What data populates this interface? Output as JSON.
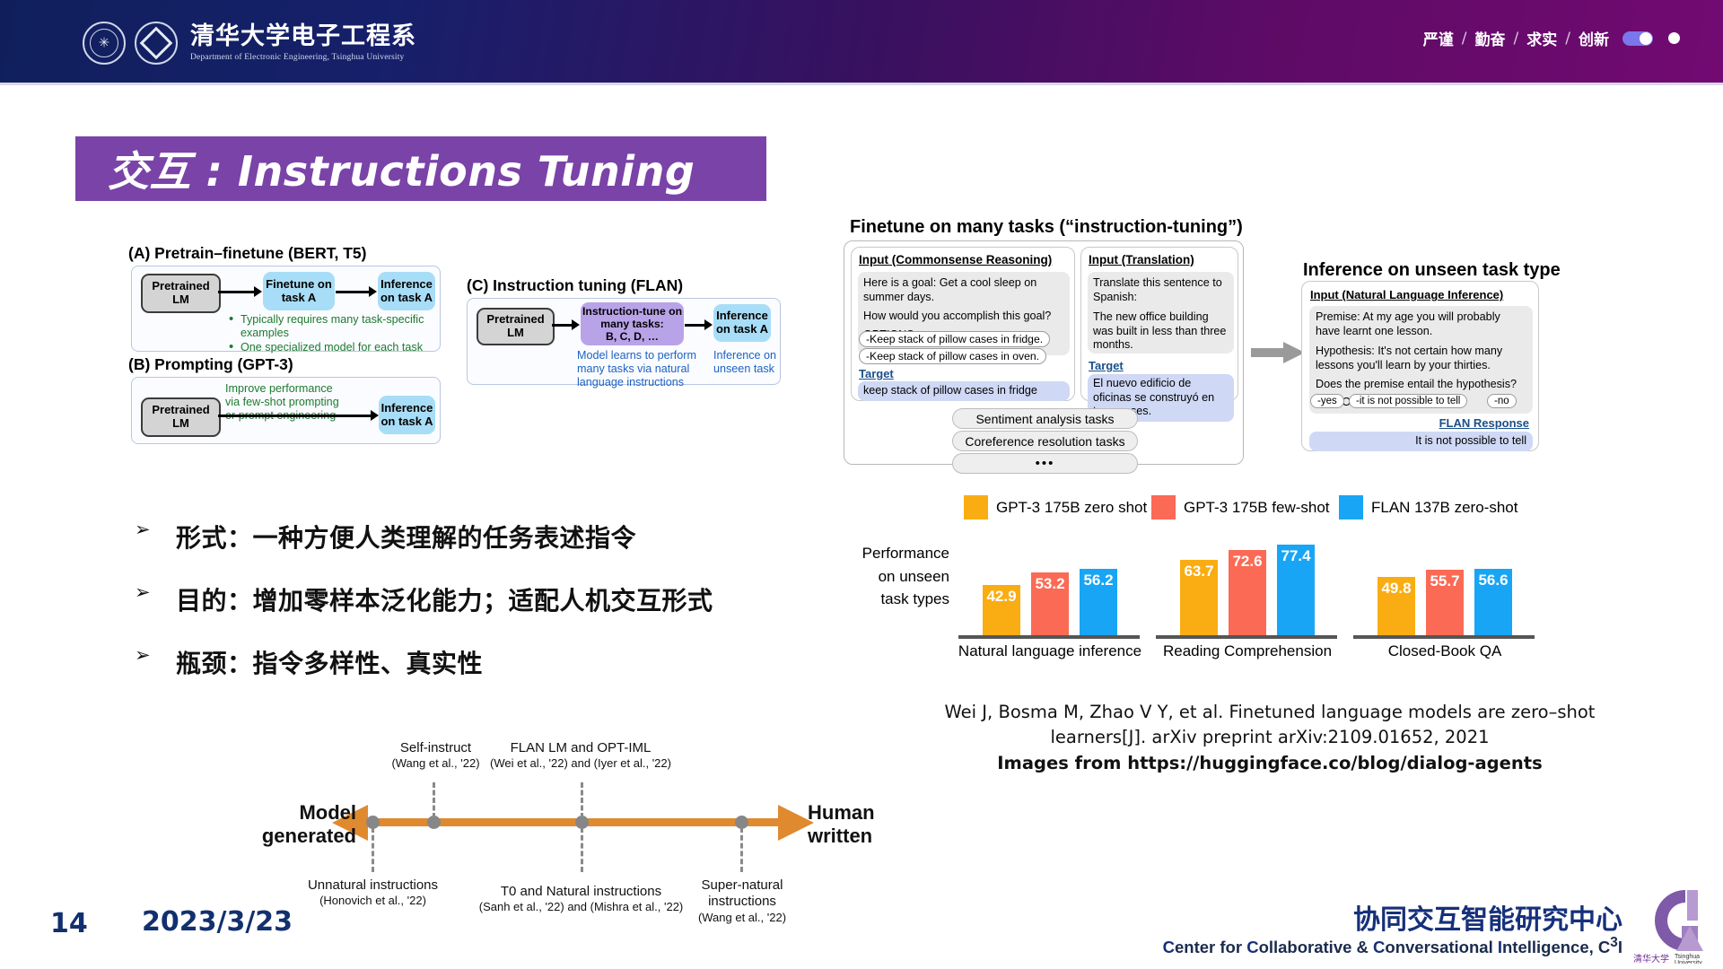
{
  "header": {
    "logo_cn": "清华大学电子工程系",
    "logo_en": "Department of Electronic Engineering, Tsinghua University",
    "motto": [
      "严谨",
      "勤奋",
      "求实",
      "创新"
    ],
    "separator": "/"
  },
  "title": {
    "text": "交互 : Instructions Tuning"
  },
  "diagrams": {
    "a": {
      "heading": "(A) Pretrain–finetune (BERT, T5)",
      "nodes": {
        "pretrained": "Pretrained\nLM",
        "finetune": "Finetune on\ntask A",
        "inference": "Inference\non task A"
      },
      "notes": [
        "Typically requires many task-specific examples",
        "One specialized model for each task"
      ]
    },
    "b": {
      "heading": "(B) Prompting (GPT-3)",
      "nodes": {
        "pretrained": "Pretrained\nLM",
        "inference": "Inference\non task A"
      },
      "note": "Improve performance\nvia few-shot prompting\nor prompt engineering"
    },
    "c": {
      "heading": "(C) Instruction tuning (FLAN)",
      "nodes": {
        "pretrained": "Pretrained\nLM",
        "tune": "Instruction-tune on\nmany tasks:\nB, C, D, …",
        "inference": "Inference\non task A"
      },
      "note_left": "Model learns to perform\nmany tasks via natural\nlanguage instructions",
      "note_right": "Inference on\nunseen task"
    }
  },
  "flan": {
    "finetune_title": "Finetune on many tasks (“instruction-tuning”)",
    "commonsense": {
      "header": "Input (Commonsense Reasoning)",
      "body_lines": [
        "Here is a goal: Get a cool sleep on summer days.",
        "How would you accomplish this goal?",
        "OPTIONS:"
      ],
      "options": [
        "-Keep stack of pillow cases in fridge.",
        "-Keep stack of pillow cases in oven."
      ],
      "target_label": "Target",
      "target_text": "keep stack of pillow cases in fridge"
    },
    "translation": {
      "header": "Input (Translation)",
      "body_lines": [
        "Translate this sentence to Spanish:",
        "The new office building was built in less than three months."
      ],
      "target_label": "Target",
      "target_text": "El nuevo edificio de oficinas se construyó en tres meses."
    },
    "more_tasks": [
      "Sentiment analysis tasks",
      "Coreference resolution tasks",
      "•••"
    ],
    "inference_title": "Inference on unseen task type",
    "nli": {
      "header": "Input (Natural Language Inference)",
      "body_lines": [
        "Premise: At my age you will probably have learnt one lesson.",
        "Hypothesis: It's not certain how many lessons you'll learn by your thirties.",
        "Does the premise entail the hypothesis?",
        "OPTIONS:"
      ],
      "options": [
        "-yes",
        "-it is not possible to tell",
        "-no"
      ],
      "response_label": "FLAN Response",
      "response_text": "It is not possible to tell"
    }
  },
  "bullets": [
    {
      "marker": "➢",
      "text": "形式：一种方便人类理解的任务表述指令"
    },
    {
      "marker": "➢",
      "text": "目的：增加零样本泛化能力；适配人机交互形式"
    },
    {
      "marker": "➢",
      "text": "瓶颈：指令多样性、真实性"
    }
  ],
  "chart_data": {
    "type": "bar",
    "title": "",
    "ylabel": "Performance on unseen task types",
    "ylabel_lines": [
      "Performance",
      "on unseen",
      "task types"
    ],
    "categories": [
      "Natural language inference",
      "Reading Comprehension",
      "Closed-Book QA"
    ],
    "series": [
      {
        "name": "GPT-3 175B zero shot",
        "color": "#f9ad13",
        "values": [
          42.9,
          63.7,
          49.8
        ]
      },
      {
        "name": "GPT-3 175B few-shot",
        "color": "#fb6a55",
        "values": [
          53.2,
          72.6,
          55.7
        ]
      },
      {
        "name": "FLAN 137B zero-shot",
        "color": "#18a5f5",
        "values": [
          56.2,
          77.4,
          56.6
        ]
      }
    ],
    "ylim": [
      0,
      90
    ],
    "grid": false,
    "legend_position": "top"
  },
  "citation": {
    "line1": "Wei J, Bosma M, Zhao V Y, et al. Finetuned language models are zero–shot",
    "line2": "learners[J]. arXiv preprint arXiv:2109.01652, 2021",
    "line3": "Images from https://huggingface.co/blog/dialog-agents"
  },
  "timeline": {
    "left_label": "Model\ngenerated",
    "right_label": "Human\nwritten",
    "above": [
      {
        "name": "Self-instruct",
        "cite": "(Wang et al., '22)"
      },
      {
        "name": "FLAN LM and OPT-IML",
        "cite": "(Wei et al., '22) and (Iyer et al., '22)"
      }
    ],
    "below": [
      {
        "name": "Unnatural instructions",
        "cite": "(Honovich et al., '22)"
      },
      {
        "name": "T0 and Natural instructions",
        "cite": "(Sanh et al., '22) and (Mishra et al., '22)"
      },
      {
        "name": "Super-natural\ninstructions",
        "cite": "(Wang et al., '22)"
      }
    ]
  },
  "footer": {
    "page_number": "14",
    "date": "2023/3/23",
    "center_cn": "协同交互智能研究中心",
    "center_en_parts": [
      "C",
      "enter for ",
      "C",
      "ollaborative & ",
      "C",
      "onversational ",
      "I",
      "ntelligence, C",
      "3",
      "I"
    ],
    "center_en": "Center for Collaborative & Conversational Intelligence, C3I",
    "logo_cn": "清华大学",
    "logo_en": "Tsinghua University"
  },
  "colors": {
    "header_navy": "#101f5c",
    "header_purple": "#720a72",
    "banner_purple": "#7a43a8",
    "footer_blue": "#16307a",
    "timeline_orange": "#e08a30"
  }
}
